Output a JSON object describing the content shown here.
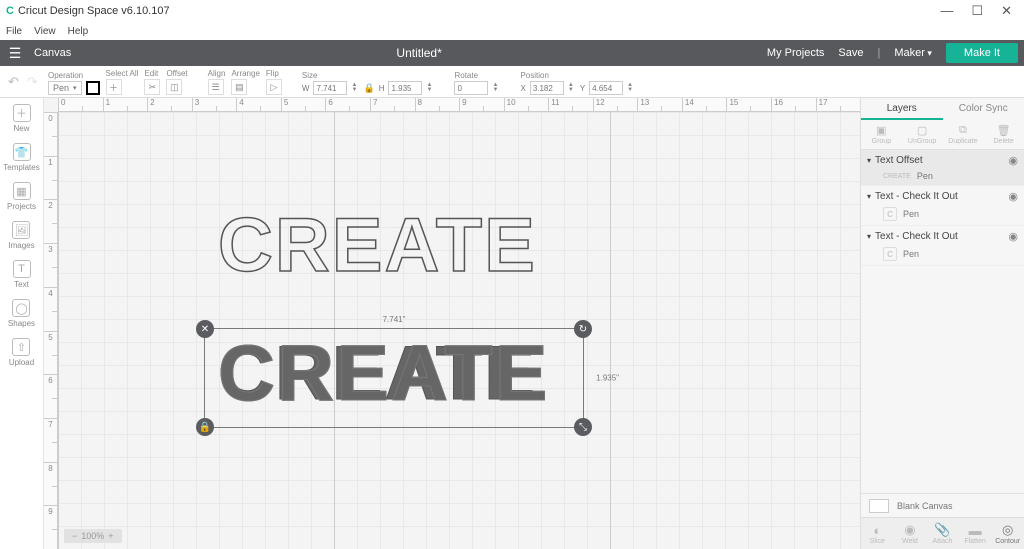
{
  "app": {
    "title": "Cricut Design Space v6.10.107"
  },
  "menubar": [
    "File",
    "View",
    "Help"
  ],
  "topbar": {
    "canvas_label": "Canvas",
    "doc_title": "Untitled*",
    "my_projects": "My Projects",
    "save": "Save",
    "machine": "Maker",
    "make_it": "Make It"
  },
  "toolbar": {
    "operation_label": "Operation",
    "operation_value": "Pen",
    "select_all": "Select All",
    "edit": "Edit",
    "offset": "Offset",
    "align": "Align",
    "arrange": "Arrange",
    "flip": "Flip",
    "size": "Size",
    "w": "7.741",
    "h": "1.935",
    "rotate": "Rotate",
    "rotate_val": "0",
    "position": "Position",
    "x": "3.182",
    "y": "4.654"
  },
  "leftnav": [
    {
      "label": "New"
    },
    {
      "label": "Templates"
    },
    {
      "label": "Projects"
    },
    {
      "label": "Images"
    },
    {
      "label": "Text"
    },
    {
      "label": "Shapes"
    },
    {
      "label": "Upload"
    }
  ],
  "selection": {
    "w_label": "7.741\"",
    "h_label": "1.935\""
  },
  "canvas_text": "CREATE",
  "zoom": "100%",
  "rightpanel": {
    "tabs": [
      "Layers",
      "Color Sync"
    ],
    "actions": [
      "Group",
      "UnGroup",
      "Duplicate",
      "Delete"
    ],
    "layers": [
      {
        "name": "Text Offset",
        "sub_label": "Pen",
        "sub_prefix": "CREATE",
        "selected": true
      },
      {
        "name": "Text - Check It Out",
        "sub_label": "Pen",
        "thumb": "C"
      },
      {
        "name": "Text - Check It Out",
        "sub_label": "Pen",
        "thumb": "C"
      }
    ],
    "blank_canvas": "Blank Canvas",
    "bottom": [
      "Slice",
      "Weld",
      "Attach",
      "Flatten",
      "Contour"
    ]
  }
}
